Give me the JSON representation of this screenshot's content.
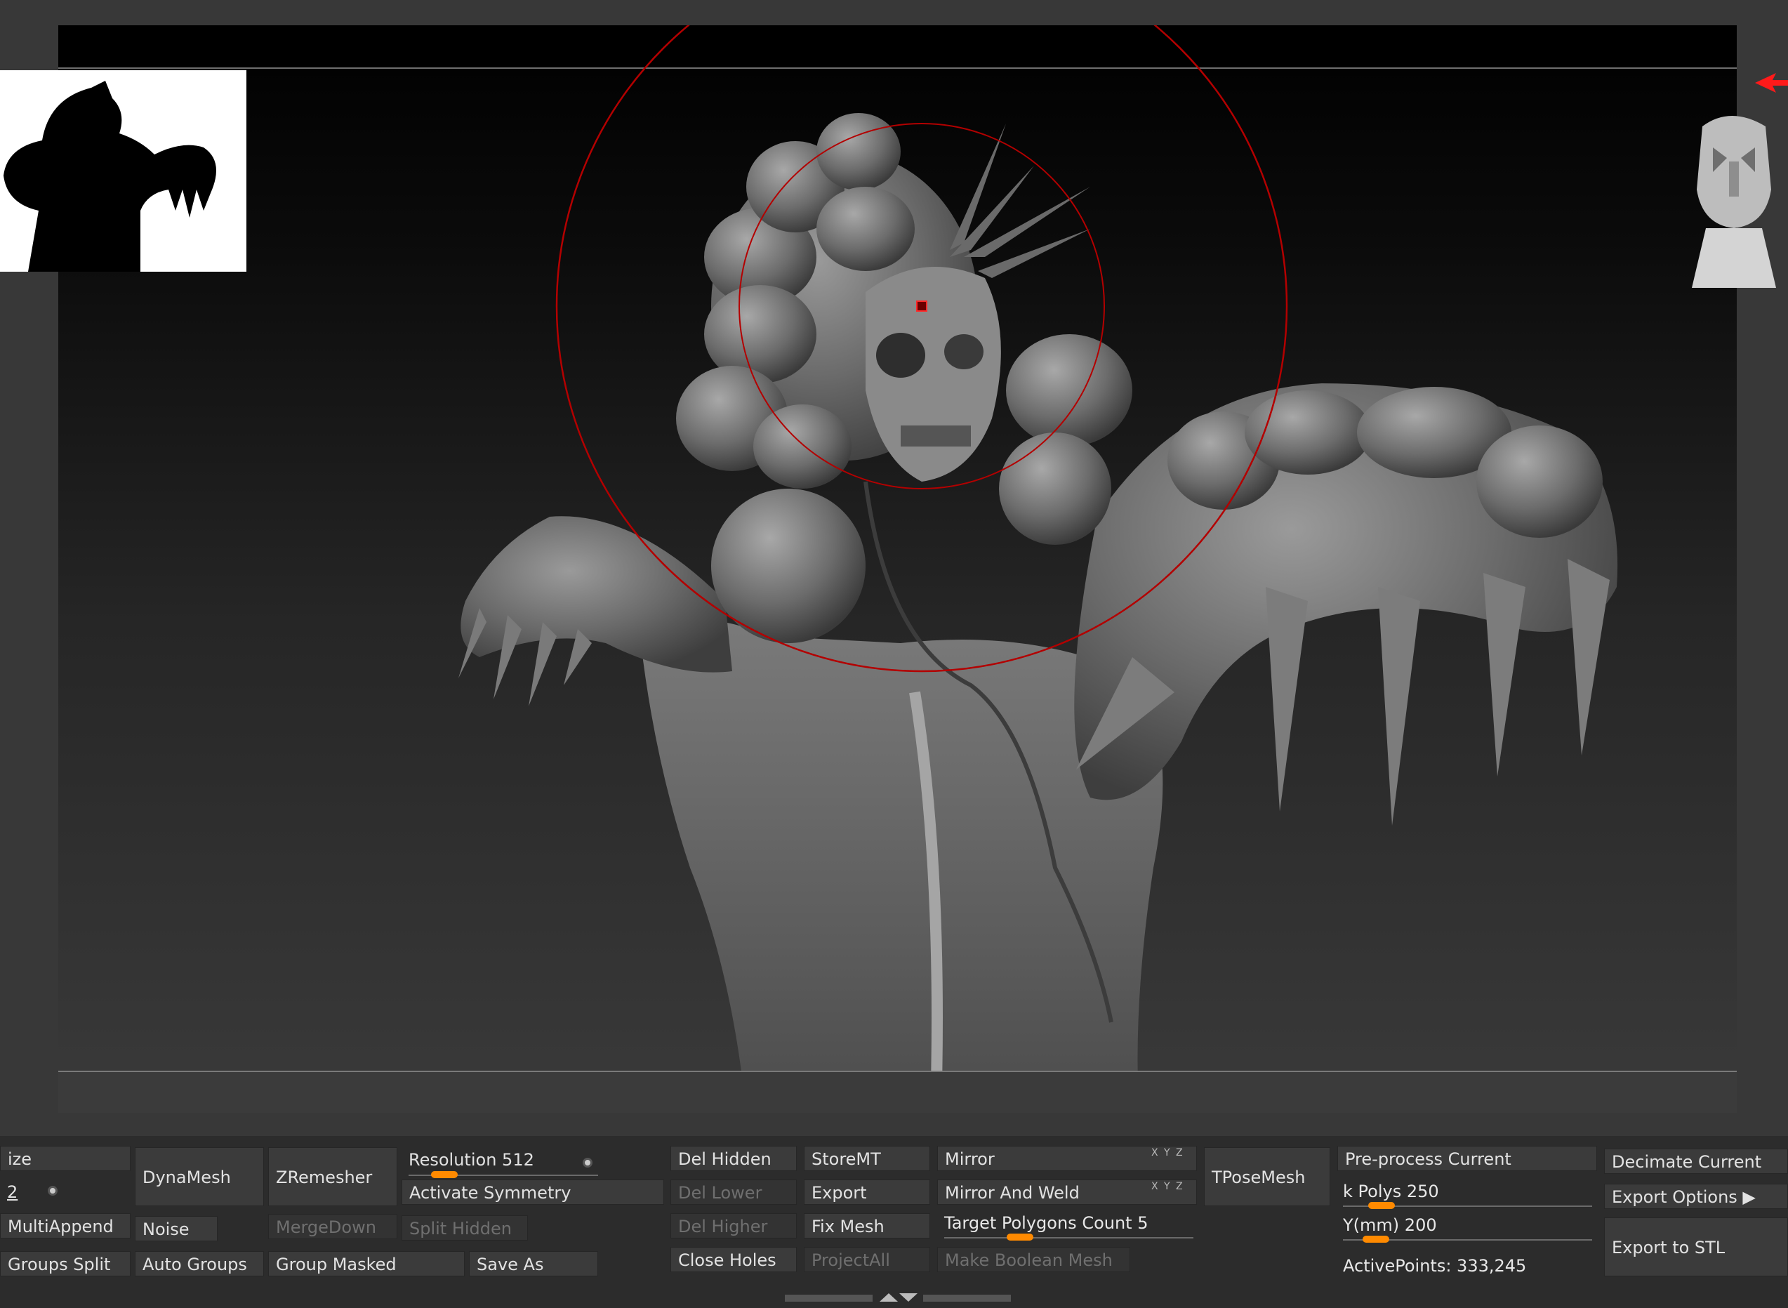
{
  "colors": {
    "accent_slider": "#ff8a00",
    "brush_circle": "#b30000",
    "panel_bg": "#2c2c2c",
    "button_bg": "#3b3b3b"
  },
  "viewport": {
    "model_name_icon": "sculpted-creature-bust",
    "silhouette_icon": "creature-silhouette",
    "nav_icon": "orientation-head-icon"
  },
  "panel": {
    "col1": {
      "size_label": "ize",
      "size_value": "2",
      "multiappend": "MultiAppend",
      "groups_split": "Groups Split"
    },
    "col2": {
      "dynamesh": "DynaMesh",
      "noise": "Noise",
      "auto_groups": "Auto Groups"
    },
    "col3": {
      "zremesher": "ZRemesher",
      "mergedown": "MergeDown",
      "group_masked": "Group Masked"
    },
    "col4": {
      "resolution_label": "Resolution",
      "resolution_value": "512",
      "resolution_fraction": 0.12,
      "activate_symmetry": "Activate Symmetry",
      "split_hidden": "Split Hidden",
      "save_as": "Save As"
    },
    "col5": {
      "del_hidden": "Del Hidden",
      "del_lower": "Del Lower",
      "del_higher": "Del Higher",
      "close_holes": "Close Holes"
    },
    "col6": {
      "storemt": "StoreMT",
      "export": "Export",
      "fix_mesh": "Fix Mesh",
      "projectall": "ProjectAll"
    },
    "col7": {
      "mirror": "Mirror",
      "mirror_weld": "Mirror And Weld",
      "xyz": "X Y Z",
      "target_poly_label": "Target Polygons Count",
      "target_poly_value": "5",
      "target_poly_fraction": 0.25,
      "make_boolean": "Make Boolean Mesh"
    },
    "col8": {
      "tposemesh": "TPoseMesh"
    },
    "col9": {
      "preprocess": "Pre-process Current",
      "kpolys_label": "k Polys",
      "kpolys_value": "250",
      "kpolys_fraction": 0.1,
      "ymm_label": "Y(mm)",
      "ymm_value": "200",
      "ymm_fraction": 0.08,
      "active_points": "ActivePoints: 333,245"
    },
    "col10": {
      "decimate_current": "Decimate Current",
      "export_options": "Export Options ▶",
      "export_stl": "Export to STL"
    }
  }
}
